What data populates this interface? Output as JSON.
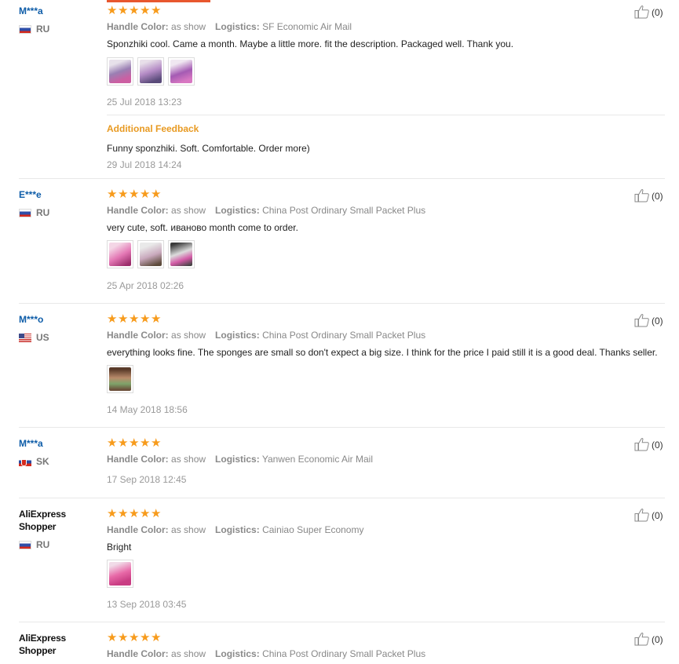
{
  "reviews": [
    {
      "buyer": "M***a",
      "buyer_style": "masked",
      "country": "RU",
      "flag": "ru",
      "stars": 5,
      "meta": {
        "color_label": "Handle Color:",
        "color_value": "as show",
        "log_label": "Logistics:",
        "log_value": "SF Economic Air Mail"
      },
      "text": "Sponzhiki cool. Came a month. Maybe a little more. fit the description. Packaged well. Thank you.",
      "photos": 3,
      "date": "25 Jul 2018 13:23",
      "feedback": {
        "title": "Additional Feedback",
        "text": "Funny sponzhiki. Soft. Comfortable. Order more)",
        "date": "29 Jul 2018 14:24"
      },
      "likes": "(0)"
    },
    {
      "buyer": "E***e",
      "buyer_style": "masked",
      "country": "RU",
      "flag": "ru",
      "stars": 5,
      "meta": {
        "color_label": "Handle Color:",
        "color_value": "as show",
        "log_label": "Logistics:",
        "log_value": "China Post Ordinary Small Packet Plus"
      },
      "text": "very cute, soft. иваново month come to order.",
      "photos": 3,
      "date": "25 Apr 2018 02:26",
      "likes": "(0)"
    },
    {
      "buyer": "M***o",
      "buyer_style": "masked",
      "country": "US",
      "flag": "us",
      "stars": 5,
      "meta": {
        "color_label": "Handle Color:",
        "color_value": "as show",
        "log_label": "Logistics:",
        "log_value": "China Post Ordinary Small Packet Plus"
      },
      "text": "everything looks fine. The sponges are small so don't expect a big size. I think for the price I paid still it is a good deal. Thanks seller.",
      "photos": 1,
      "date": "14 May 2018 18:56",
      "likes": "(0)"
    },
    {
      "buyer": "M***a",
      "buyer_style": "masked",
      "country": "SK",
      "flag": "sk",
      "stars": 5,
      "meta": {
        "color_label": "Handle Color:",
        "color_value": "as show",
        "log_label": "Logistics:",
        "log_value": "Yanwen Economic Air Mail"
      },
      "text": "",
      "photos": 0,
      "date": "17 Sep 2018 12:45",
      "likes": "(0)"
    },
    {
      "buyer": "AliExpress Shopper",
      "buyer_style": "shopper",
      "country": "RU",
      "flag": "ru",
      "stars": 5,
      "meta": {
        "color_label": "Handle Color:",
        "color_value": "as show",
        "log_label": "Logistics:",
        "log_value": "Cainiao Super Economy"
      },
      "text": "Bright",
      "photos": 1,
      "date": "13 Sep 2018 03:45",
      "likes": "(0)"
    },
    {
      "buyer": "AliExpress Shopper",
      "buyer_style": "shopper",
      "country": "",
      "flag": "",
      "stars": 5,
      "meta": {
        "color_label": "Handle Color:",
        "color_value": "as show",
        "log_label": "Logistics:",
        "log_value": "China Post Ordinary Small Packet Plus"
      },
      "text": "",
      "photos": 0,
      "date": "",
      "likes": "(0)"
    }
  ],
  "colors": {
    "star": "#f79b1c",
    "buyer_link": "#0d5ca8",
    "feedback_title": "#e89a22",
    "accent_bar": "#e8572e"
  },
  "icons": {
    "like": "thumbs-up-icon",
    "star": "star-icon"
  }
}
